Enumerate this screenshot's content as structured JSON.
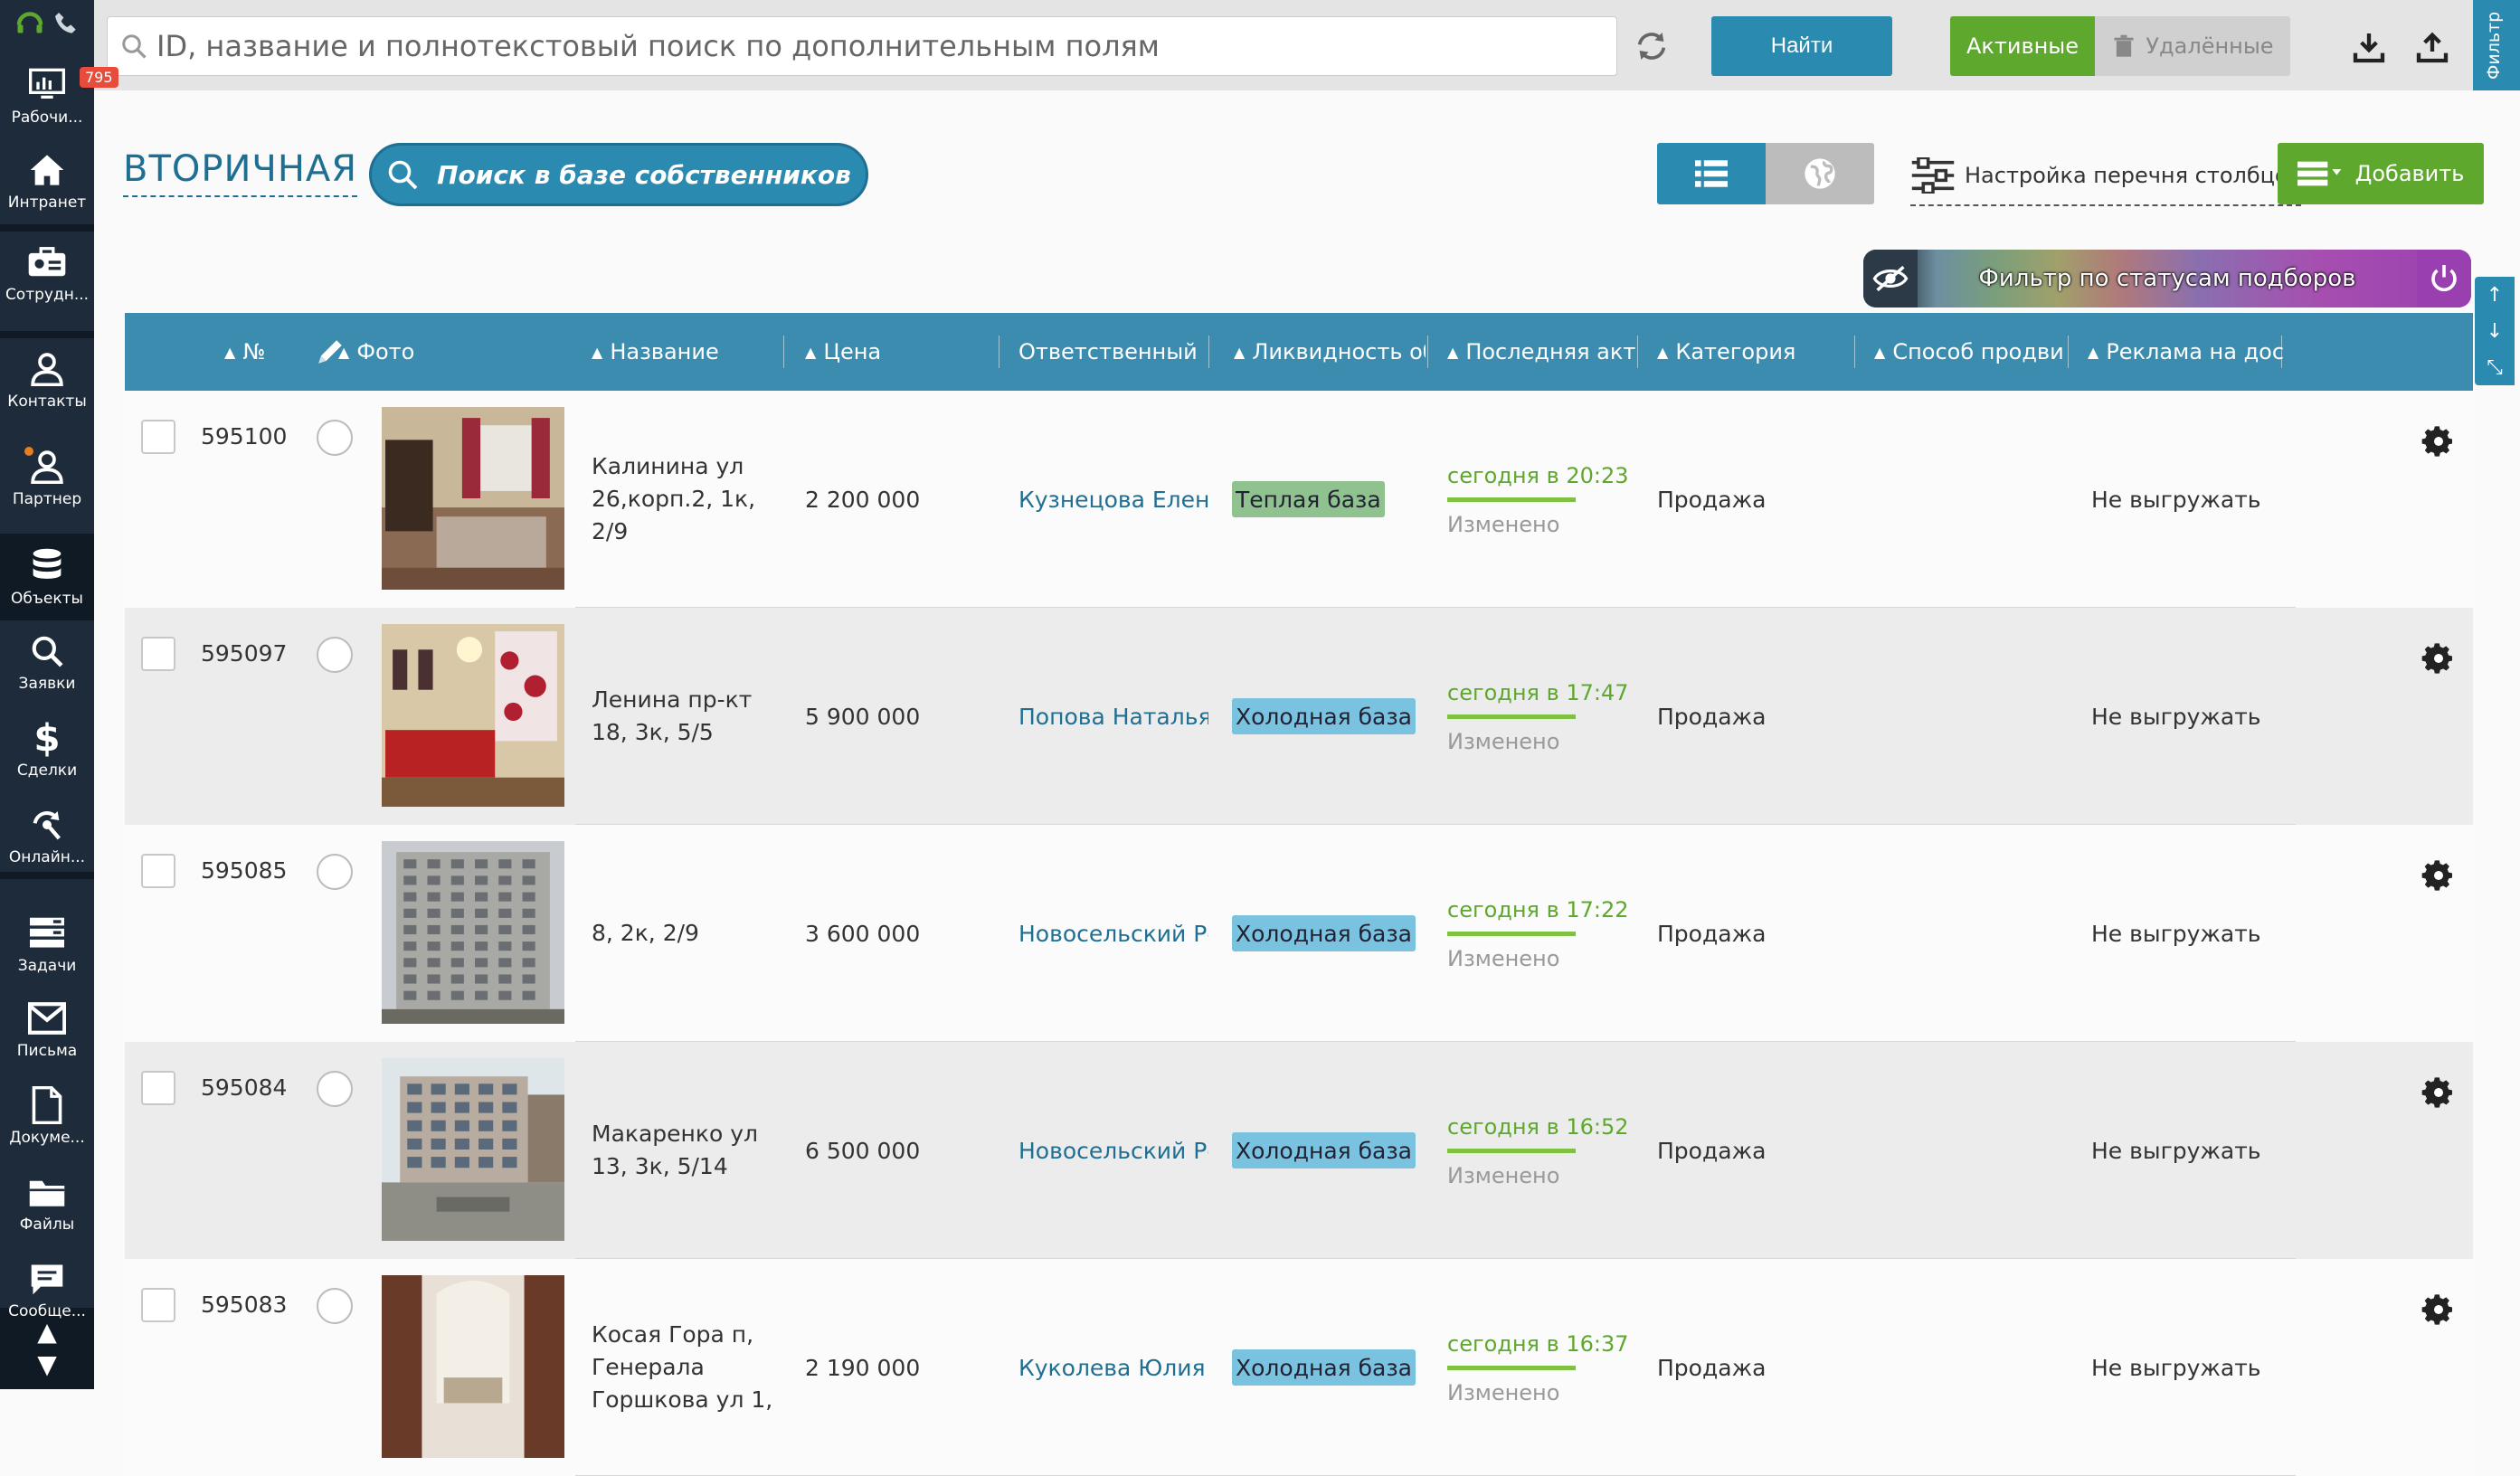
{
  "sidebar": {
    "items": [
      {
        "label": "Рабочи...",
        "icon": "dashboard-icon",
        "badge": "795"
      },
      {
        "label": "Интранет",
        "icon": "home-icon"
      },
      {
        "label": "Сотрудн...",
        "icon": "employees-icon"
      },
      {
        "label": "Контакты",
        "icon": "contacts-icon"
      },
      {
        "label": "Партнер",
        "icon": "partner-icon"
      },
      {
        "label": "Объекты",
        "icon": "database-icon"
      },
      {
        "label": "Заявки",
        "icon": "search-icon"
      },
      {
        "label": "Сделки",
        "icon": "dollar-icon"
      },
      {
        "label": "Онлайн...",
        "icon": "online-icon"
      },
      {
        "label": "Задачи",
        "icon": "tasks-icon"
      },
      {
        "label": "Письма",
        "icon": "mail-icon"
      },
      {
        "label": "Докуме...",
        "icon": "document-icon"
      },
      {
        "label": "Файлы",
        "icon": "folder-icon"
      },
      {
        "label": "Сообще...",
        "icon": "message-icon"
      }
    ]
  },
  "topbar": {
    "search_placeholder": "ID, название и полнотекстовый поиск по дополнительным полям",
    "find_label": "Найти",
    "active_label": "Активные",
    "deleted_label": "Удалённые",
    "filter_label": "Фильтр"
  },
  "section": {
    "title": "ВТОРИЧНАЯ",
    "owners_search_label": "Поиск в базе собственников",
    "columns_config_label": "Настройка перечня столбцов",
    "add_label": "Добавить",
    "status_filter_label": "Фильтр по статусам подборов"
  },
  "table": {
    "columns": [
      "№",
      "Фото",
      "Название",
      "Цена",
      "Ответственный",
      "Ликвидность об",
      "Последняя акт",
      "Категория",
      "Способ продви",
      "Реклама на дос"
    ],
    "rows": [
      {
        "id": "595100",
        "name": "Калинина ул 26,корп.2, 1к, 2/9",
        "price": "2 200 000",
        "responsible": "Кузнецова Елена",
        "liquidity": "Теплая база",
        "liquidity_type": "warm",
        "last_activity": "сегодня в 20:23",
        "activity_status": "Изменено",
        "category": "Продажа",
        "ad": "Не выгружать",
        "photo": "room1"
      },
      {
        "id": "595097",
        "name": "Ленина пр-кт 18, 3к, 5/5",
        "price": "5 900 000",
        "responsible": "Попова Наталья",
        "liquidity": "Холодная база",
        "liquidity_type": "cold",
        "last_activity": "сегодня в 17:47",
        "activity_status": "Изменено",
        "category": "Продажа",
        "ad": "Не выгружать",
        "photo": "room2"
      },
      {
        "id": "595085",
        "name": "8, 2к, 2/9",
        "price": "3 600 000",
        "responsible": "Новосельский Ро",
        "liquidity": "Холодная база",
        "liquidity_type": "cold",
        "last_activity": "сегодня в 17:22",
        "activity_status": "Изменено",
        "category": "Продажа",
        "ad": "Не выгружать",
        "photo": "building1"
      },
      {
        "id": "595084",
        "name": "Макаренко ул 13, 3к, 5/14",
        "price": "6 500 000",
        "responsible": "Новосельский Ро",
        "liquidity": "Холодная база",
        "liquidity_type": "cold",
        "last_activity": "сегодня в 16:52",
        "activity_status": "Изменено",
        "category": "Продажа",
        "ad": "Не выгружать",
        "photo": "building2"
      },
      {
        "id": "595083",
        "name": "Косая Гора п, Генерала Горшкова ул 1,",
        "price": "2 190 000",
        "responsible": "Куколева Юлия",
        "liquidity": "Холодная база",
        "liquidity_type": "cold",
        "last_activity": "сегодня в 16:37",
        "activity_status": "Изменено",
        "category": "Продажа",
        "ad": "Не выгружать",
        "photo": "room3"
      }
    ]
  },
  "colors": {
    "sidebar_bg": "#1d2b3a",
    "accent_blue": "#2a8ab0",
    "accent_green": "#5ea82e",
    "header_blue": "#3c8caf"
  }
}
